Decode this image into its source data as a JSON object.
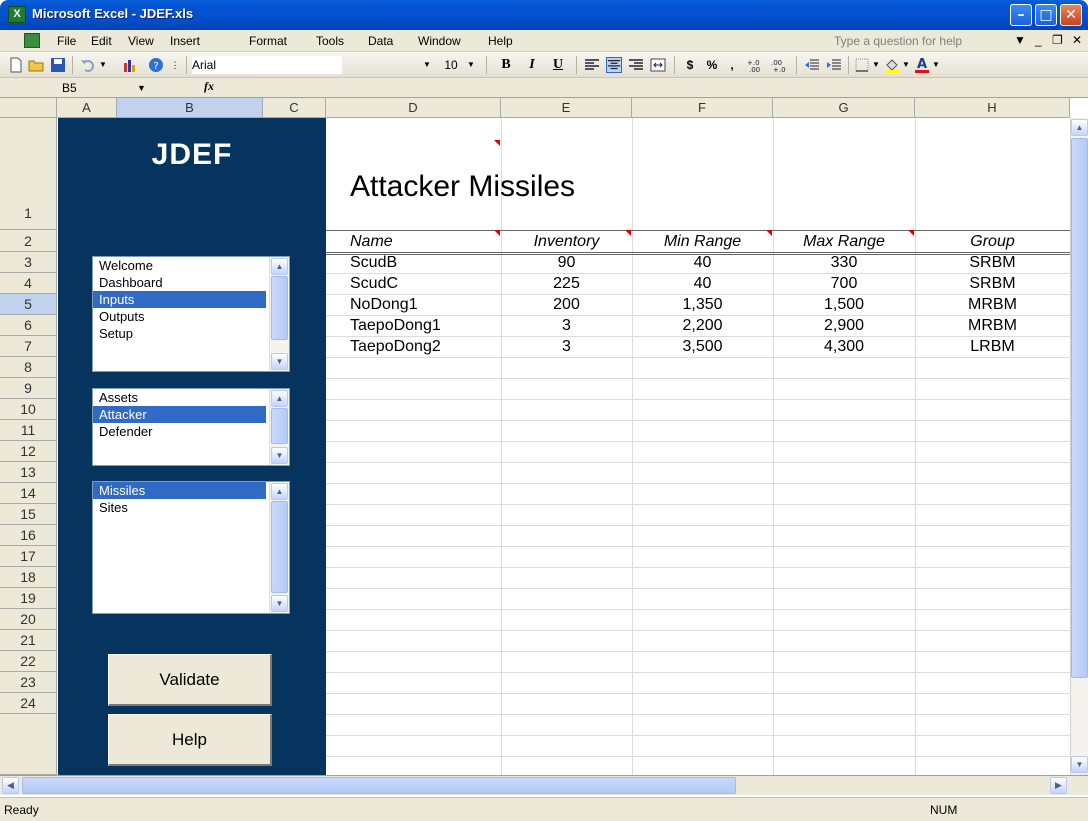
{
  "window": {
    "title": "Microsoft Excel - JDEF.xls",
    "app_icon": "excel-icon"
  },
  "menu": {
    "items": [
      "File",
      "Edit",
      "View",
      "Insert",
      "Format",
      "Tools",
      "Data",
      "Window",
      "Help"
    ],
    "help_placeholder": "Type a question for help"
  },
  "toolbar": {
    "font_name": "Arial",
    "font_size": "10",
    "bold": "B",
    "italic": "I",
    "underline": "U",
    "currency": "$",
    "percent": "%",
    "comma": ","
  },
  "formula_bar": {
    "name_box": "B5",
    "fx_label": "fx",
    "content": ""
  },
  "columns": [
    "A",
    "B",
    "C",
    "D",
    "E",
    "F",
    "G",
    "H"
  ],
  "rows": [
    "1",
    "2",
    "3",
    "4",
    "5",
    "6",
    "7",
    "8",
    "9",
    "10",
    "11",
    "12",
    "13",
    "14",
    "15",
    "16",
    "17",
    "18",
    "19",
    "20",
    "21",
    "22",
    "23",
    "24"
  ],
  "panel": {
    "title": "JDEF",
    "nav_list": {
      "items": [
        "Welcome",
        "Dashboard",
        "Inputs",
        "Outputs",
        "Setup"
      ],
      "selected": "Inputs"
    },
    "side_list": {
      "items": [
        "Assets",
        "Attacker",
        "Defender"
      ],
      "selected": "Attacker"
    },
    "type_list": {
      "items": [
        "Missiles",
        "Sites"
      ],
      "selected": "Missiles"
    },
    "validate_label": "Validate",
    "help_label": "Help"
  },
  "sheet": {
    "title": "Attacker Missiles",
    "headers": [
      "Name",
      "Inventory",
      "Min Range",
      "Max Range",
      "Group"
    ],
    "rows": [
      [
        "ScudB",
        "90",
        "40",
        "330",
        "SRBM"
      ],
      [
        "ScudC",
        "225",
        "40",
        "700",
        "SRBM"
      ],
      [
        "NoDong1",
        "200",
        "1,350",
        "1,500",
        "MRBM"
      ],
      [
        "TaepoDong1",
        "3",
        "2,200",
        "2,900",
        "MRBM"
      ],
      [
        "TaepoDong2",
        "3",
        "3,500",
        "4,300",
        "LRBM"
      ]
    ]
  },
  "status": {
    "left": "Ready",
    "num": "NUM"
  }
}
